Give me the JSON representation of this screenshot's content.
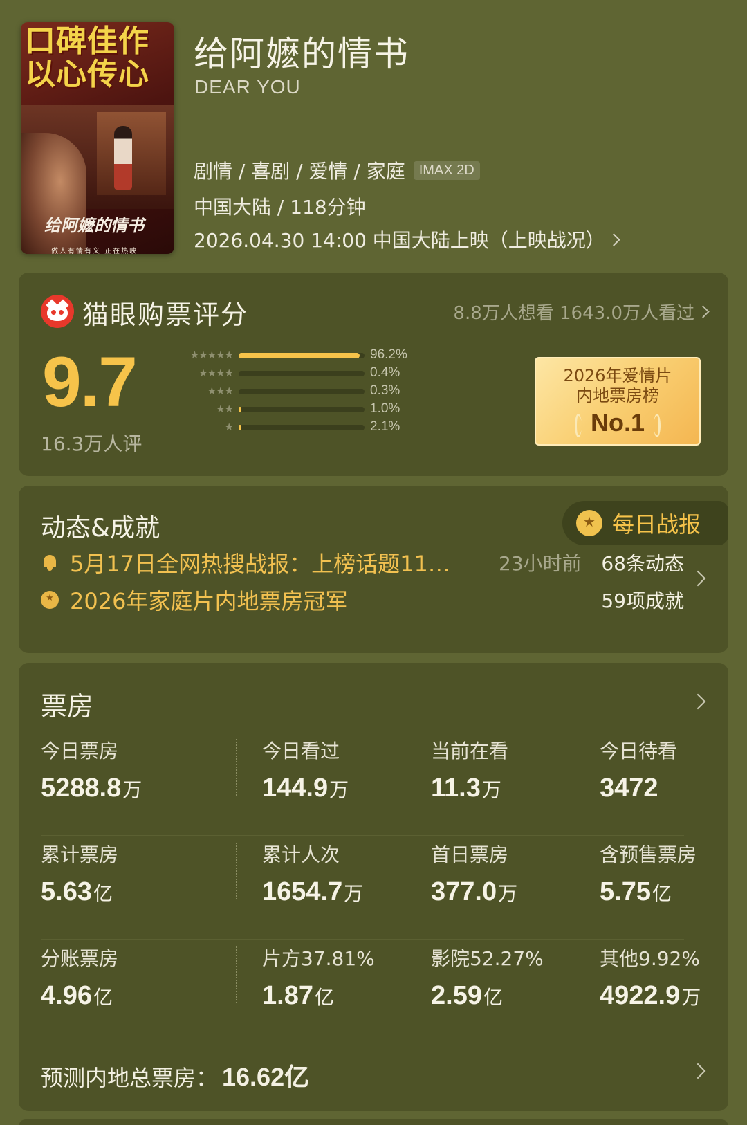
{
  "poster": {
    "headline_line1": "口碑佳作",
    "headline_line2": "以心传心",
    "script_title": "给阿嬷的情书",
    "tagline": "做人有情有义 正在热映"
  },
  "movie": {
    "title": "给阿嬷的情书",
    "english_title": "DEAR YOU",
    "genres": "剧情 / 喜剧 / 爱情 / 家庭",
    "format_badge": "IMAX 2D",
    "region_duration": "中国大陆 / 118分钟",
    "release": "2026.04.30 14:00 中国大陆上映（上映战况）"
  },
  "rating": {
    "title": "猫眼购票评分",
    "stats": "8.8万人想看 1643.0万人看过",
    "score": "9.7",
    "count": "16.3万人评",
    "distribution": [
      {
        "stars": "★★★★★",
        "percent_text": "96.2%",
        "value": 96.2
      },
      {
        "stars": "★★★★",
        "percent_text": "0.4%",
        "value": 0.4
      },
      {
        "stars": "★★★",
        "percent_text": "0.3%",
        "value": 0.3
      },
      {
        "stars": "★★",
        "percent_text": "1.0%",
        "value": 1.0
      },
      {
        "stars": "★",
        "percent_text": "2.1%",
        "value": 2.1
      }
    ],
    "rank_line1": "2026年爱情片",
    "rank_line2": "内地票房榜",
    "rank_line3": "No.1"
  },
  "dynamics": {
    "title": "动态&成就",
    "daily_report": "每日战报",
    "item1_text": "5月17日全网热搜战报：上榜话题11…",
    "item1_time": "23小时前",
    "item1_count": "68条动态",
    "item2_text": "2026年家庭片内地票房冠军",
    "item2_count": "59项成就"
  },
  "box_office": {
    "title": "票房",
    "rows": [
      [
        {
          "label": "今日票房",
          "value": "5288.8",
          "unit": "万"
        },
        {
          "label": "今日看过",
          "value": "144.9",
          "unit": "万"
        },
        {
          "label": "当前在看",
          "value": "11.3",
          "unit": "万"
        },
        {
          "label": "今日待看",
          "value": "3472",
          "unit": ""
        }
      ],
      [
        {
          "label": "累计票房",
          "value": "5.63",
          "unit": "亿"
        },
        {
          "label": "累计人次",
          "value": "1654.7",
          "unit": "万"
        },
        {
          "label": "首日票房",
          "value": "377.0",
          "unit": "万"
        },
        {
          "label": "含预售票房",
          "value": "5.75",
          "unit": "亿"
        }
      ],
      [
        {
          "label": "分账票房",
          "value": "4.96",
          "unit": "亿"
        },
        {
          "label": "片方37.81%",
          "value": "1.87",
          "unit": "亿"
        },
        {
          "label": "影院52.27%",
          "value": "2.59",
          "unit": "亿"
        },
        {
          "label": "其他9.92%",
          "value": "4922.9",
          "unit": "万"
        }
      ]
    ],
    "forecast_label": "预测内地总票房：",
    "forecast_value": "16.62亿"
  }
}
